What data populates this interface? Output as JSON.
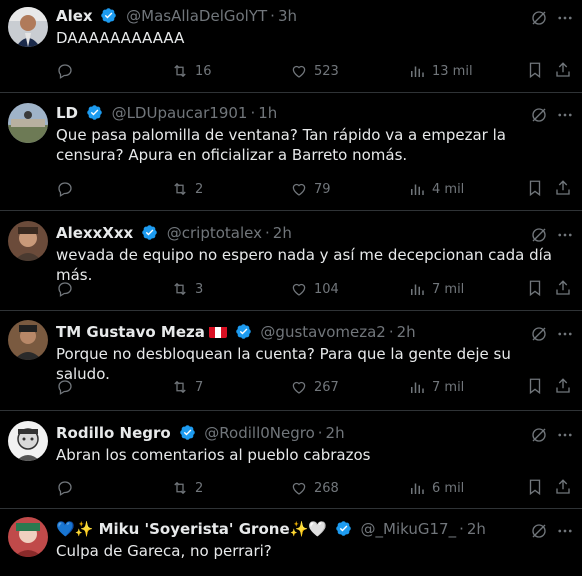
{
  "colors": {
    "background": "#000000",
    "text": "#e7e9ea",
    "muted": "#71767b",
    "verified": "#1d9bf0",
    "divider": "#2f3336"
  },
  "tweets": [
    {
      "name": "Alex",
      "handle": "@MasAllaDelGolYT",
      "dot": "·",
      "time": "3h",
      "text": "DAAAAAAAAAAA",
      "replies": "",
      "retweets": "16",
      "likes": "523",
      "views": "13 mil"
    },
    {
      "name": "LD",
      "handle": "@LDUpaucar1901",
      "dot": "·",
      "time": "1h",
      "text": "Que pasa palomilla de ventana? Tan rápido va a empezar la censura? Apura en oficializar a Barreto nomás.",
      "replies": "",
      "retweets": "2",
      "likes": "79",
      "views": "4 mil"
    },
    {
      "name": "AlexxXxx",
      "handle": "@criptotalex",
      "dot": "·",
      "time": "2h",
      "text": "wevada de equipo no espero nada y así me decepcionan cada día más.",
      "replies": "",
      "retweets": "3",
      "likes": "104",
      "views": "7 mil"
    },
    {
      "name": "TM Gustavo Meza",
      "handle": "@gustavomeza2",
      "dot": "·",
      "time": "2h",
      "text": "Porque no desbloquean la cuenta? Para que la gente deje su saludo.",
      "replies": "",
      "retweets": "7",
      "likes": "267",
      "views": "7 mil",
      "flag": "peru-flag-icon"
    },
    {
      "name": "Rodillo Negro",
      "handle": "@Rodill0Negro",
      "dot": "·",
      "time": "2h",
      "text": "Abran los comentarios al pueblo cabrazos",
      "replies": "",
      "retweets": "2",
      "likes": "268",
      "views": "6 mil"
    },
    {
      "name": "💙✨ Miku 'Soyerista' Grone✨🤍",
      "handle": "@_MikuG17_",
      "dot": "·",
      "time": "2h",
      "text": "Culpa de Gareca, no perrari?"
    }
  ]
}
